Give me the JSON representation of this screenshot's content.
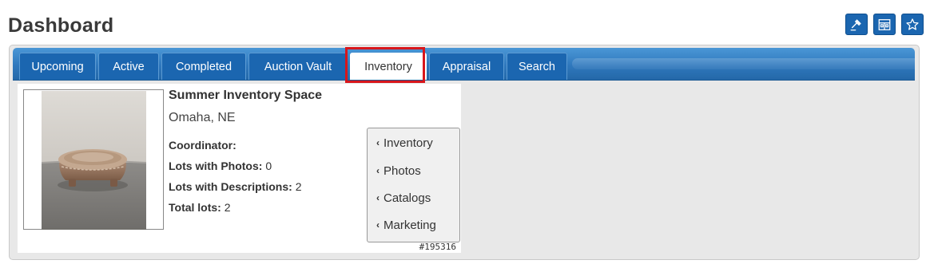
{
  "header": {
    "title": "Dashboard"
  },
  "header_actions": [
    {
      "name": "gavel-icon"
    },
    {
      "name": "building-icon"
    },
    {
      "name": "star-icon"
    }
  ],
  "tabs": [
    {
      "label": "Upcoming"
    },
    {
      "label": "Active"
    },
    {
      "label": "Completed"
    },
    {
      "label": "Auction Vault"
    },
    {
      "label": "Inventory",
      "active": true
    },
    {
      "label": "Appraisal"
    },
    {
      "label": "Search"
    }
  ],
  "inventory_card": {
    "title": "Summer Inventory Space",
    "location": "Omaha, NE",
    "coordinator_label": "Coordinator:",
    "coordinator_value": "",
    "lots_photos_label": "Lots with Photos:",
    "lots_photos_value": "0",
    "lots_desc_label": "Lots with Descriptions:",
    "lots_desc_value": "2",
    "total_lots_label": "Total lots:",
    "total_lots_value": "2",
    "id": "#195316",
    "thumbnail": "decorative-box-photo",
    "menu": [
      {
        "label": "Inventory"
      },
      {
        "label": "Photos"
      },
      {
        "label": "Catalogs"
      },
      {
        "label": "Marketing"
      }
    ]
  },
  "colors": {
    "tab_blue": "#1b66b0",
    "active_outline": "#d8161b"
  }
}
